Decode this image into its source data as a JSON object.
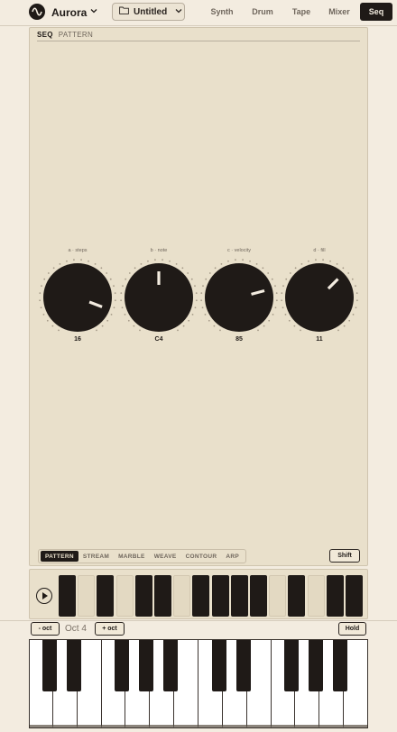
{
  "app": {
    "name": "Aurora",
    "logo_icon": "waveform-icon",
    "menu_icon": "chevron-down-icon"
  },
  "file": {
    "name": "Untitled",
    "icon": "folder-icon",
    "menu_icon": "chevron-down-icon"
  },
  "nav": [
    {
      "label": "Synth",
      "active": false
    },
    {
      "label": "Drum",
      "active": false
    },
    {
      "label": "Tape",
      "active": false
    },
    {
      "label": "Mixer",
      "active": false
    },
    {
      "label": "Seq",
      "active": true
    }
  ],
  "panel": {
    "tabs": [
      {
        "label": "SEQ",
        "active": true
      },
      {
        "label": "PATTERN",
        "active": false
      }
    ],
    "knobs": [
      {
        "label": "a · steps",
        "value": "16",
        "level": 0.87
      },
      {
        "label": "b · note",
        "value": "C4",
        "level": 0.5
      },
      {
        "label": "c · velocity",
        "value": "85",
        "level": 0.75
      },
      {
        "label": "d · fill",
        "value": "11",
        "level": 0.65
      }
    ],
    "modes": [
      {
        "label": "PATTERN",
        "active": true
      },
      {
        "label": "STREAM",
        "active": false
      },
      {
        "label": "MARBLE",
        "active": false
      },
      {
        "label": "WEAVE",
        "active": false
      },
      {
        "label": "CONTOUR",
        "active": false
      },
      {
        "label": "ARP",
        "active": false
      }
    ],
    "shift_label": "Shift"
  },
  "sequencer": {
    "play_icon": "play-icon",
    "steps": [
      true,
      false,
      true,
      false,
      true,
      true,
      false,
      true,
      true,
      true,
      true,
      false,
      true,
      false,
      true,
      true
    ]
  },
  "keyboard": {
    "oct_down_label": "- oct",
    "oct_up_label": "+ oct",
    "date": "Oct 4",
    "hold_label": "Hold",
    "white_keys": 14,
    "black_keys": [
      0,
      1,
      3,
      4,
      5,
      7,
      8,
      10,
      11,
      12
    ]
  },
  "colors": {
    "background": "#f3ece0",
    "panel": "#e9e0cb",
    "ink": "#1f1a17",
    "muted": "#6f665c"
  }
}
